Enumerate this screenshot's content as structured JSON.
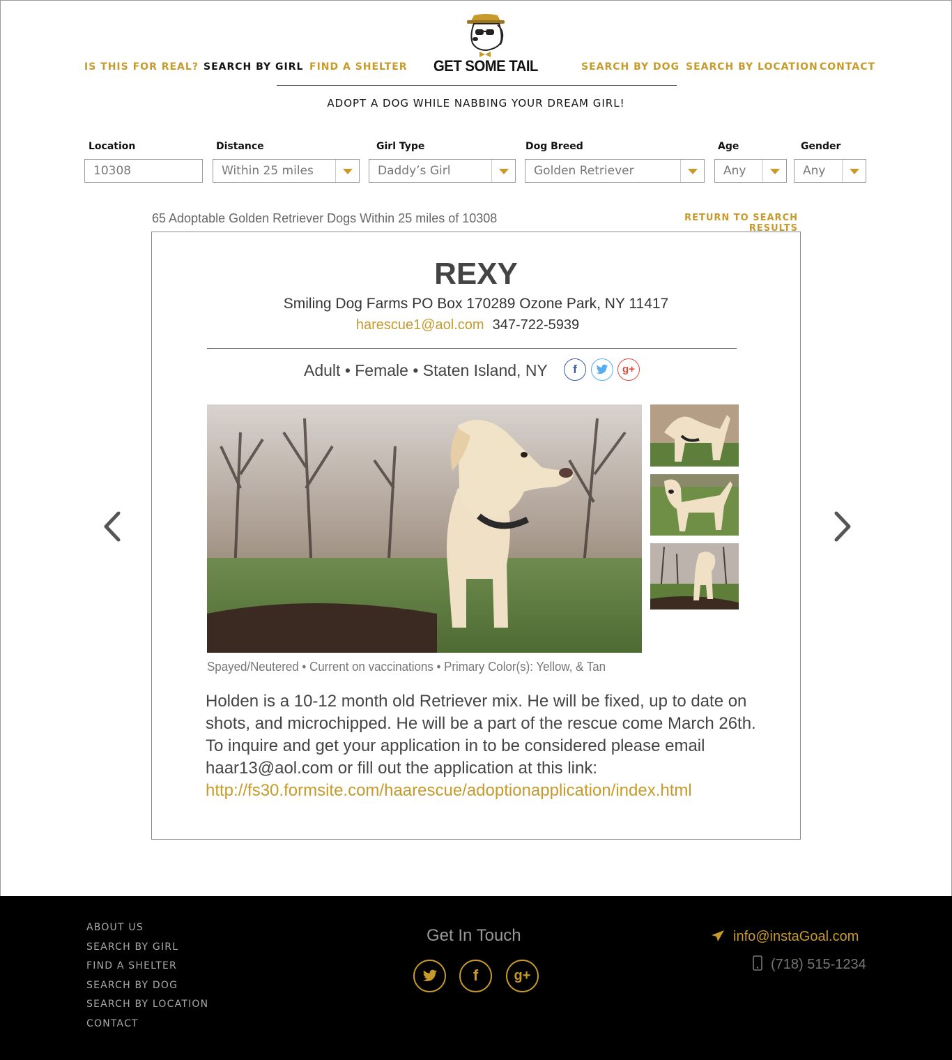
{
  "brand": {
    "title": "GET SOME TAIL",
    "tagline": "ADOPT A DOG WHILE NABBING YOUR DREAM GIRL!"
  },
  "nav": {
    "left": [
      "IS THIS FOR REAL?",
      "SEARCH BY GIRL",
      "FIND A SHELTER"
    ],
    "right": [
      "SEARCH BY DOG",
      "SEARCH BY LOCATION",
      "CONTACT"
    ],
    "active": "SEARCH BY GIRL"
  },
  "filters": {
    "location": {
      "label": "Location",
      "value": "10308"
    },
    "distance": {
      "label": "Distance",
      "value": "Within 25 miles"
    },
    "girl_type": {
      "label": "Girl Type",
      "value": "Daddy’s Girl"
    },
    "dog_breed": {
      "label": "Dog Breed",
      "value": "Golden Retriever"
    },
    "age": {
      "label": "Age",
      "value": "Any"
    },
    "gender": {
      "label": "Gender",
      "value": "Any"
    }
  },
  "results": {
    "summary": "65 Adoptable Golden Retriever Dogs Within 25 miles of 10308",
    "return_label": "RETURN TO SEARCH RESULTS"
  },
  "dog": {
    "name": "REXY",
    "shelter": "Smiling Dog Farms  PO Box 170289 Ozone Park, NY 11417",
    "email": "harescue1@aol.com",
    "phone": "347-722-5939",
    "meta": "Adult • Female • Staten Island, NY",
    "details": "Spayed/Neutered • Current on vaccinations • Primary Color(s): Yellow, & Tan",
    "description": "Holden is a 10-12 month old Retriever mix. He will be fixed, up to date on shots, and microchipped. He will be a part of the rescue come March 26th. To inquire and get your application in to be considered please email haar13@aol.com or fill out the application at this link:",
    "link": "http://fs30.formsite.com/haarescue/adoptionapplication/index.html"
  },
  "share_icons": [
    "facebook-icon",
    "twitter-icon",
    "google-plus-icon"
  ],
  "footer": {
    "links": [
      "ABOUT US",
      "SEARCH BY GIRL",
      "FIND A SHELTER",
      "SEARCH BY DOG",
      "SEARCH BY  LOCATION",
      "CONTACT"
    ],
    "get_in_touch": "Get In Touch",
    "email": "info@instaGoal.com",
    "phone": "(718) 515-1234"
  },
  "colors": {
    "accent": "#c79a2c",
    "footer_bg": "#000000",
    "facebook": "#3b5998",
    "twitter": "#55acee",
    "google": "#dd4b39"
  }
}
